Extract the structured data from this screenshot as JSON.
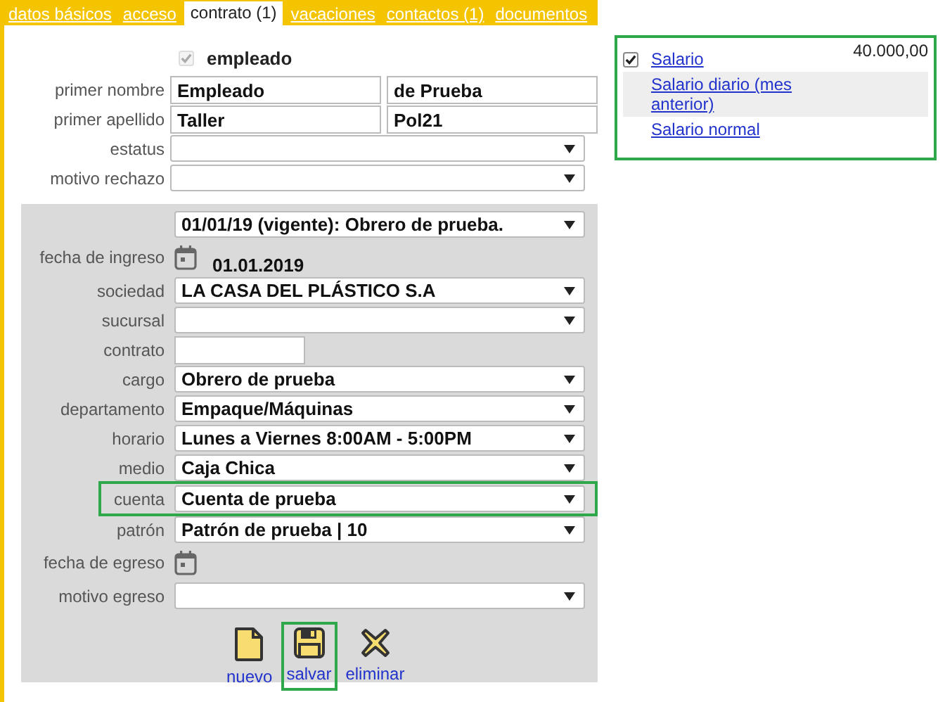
{
  "tabs": [
    {
      "label": "datos básicos",
      "selected": false
    },
    {
      "label": "acceso",
      "selected": false
    },
    {
      "label": "contrato (1)",
      "selected": true
    },
    {
      "label": "vacaciones",
      "selected": false
    },
    {
      "label": "contactos (1)",
      "selected": false
    },
    {
      "label": "documentos",
      "selected": false
    }
  ],
  "employee_checkbox": {
    "label": "empleado",
    "checked": true
  },
  "person_fields": [
    {
      "label": "primer nombre",
      "kind": "pair",
      "values": [
        "Empleado",
        "de Prueba"
      ]
    },
    {
      "label": "primer apellido",
      "kind": "pair",
      "values": [
        "Taller",
        "Pol21"
      ]
    },
    {
      "label": "estatus",
      "kind": "select"
    },
    {
      "label": "motivo rechazo",
      "kind": "select"
    }
  ],
  "contract": {
    "selector": "01/01/19 (vigente): Obrero de prueba.",
    "fields": [
      {
        "label": "fecha de ingreso",
        "kind": "date",
        "value": "01.01.2019",
        "highlighted": false
      },
      {
        "label": "sociedad",
        "kind": "select",
        "value": "LA CASA DEL PLÁSTICO S.A",
        "highlighted": false
      },
      {
        "label": "sucursal",
        "kind": "select",
        "highlighted": false
      },
      {
        "label": "contrato",
        "kind": "text",
        "highlighted": false
      },
      {
        "label": "cargo",
        "kind": "select",
        "value": "Obrero de prueba",
        "highlighted": false
      },
      {
        "label": "departamento",
        "kind": "select",
        "value": "Empaque/Máquinas",
        "highlighted": false
      },
      {
        "label": "horario",
        "kind": "select",
        "value": "Lunes a Viernes 8:00AM - 5:00PM",
        "highlighted": false
      },
      {
        "label": "medio",
        "kind": "select",
        "value": "Caja Chica",
        "highlighted": false
      },
      {
        "label": "cuenta",
        "kind": "select",
        "value": "Cuenta de prueba",
        "highlighted": true
      },
      {
        "label": "patrón",
        "kind": "select",
        "value": "Patrón de prueba | 10",
        "highlighted": false
      },
      {
        "label": "fecha de egreso",
        "kind": "date",
        "highlighted": false
      },
      {
        "label": "motivo egreso",
        "kind": "select",
        "highlighted": false
      }
    ],
    "actions": [
      {
        "label": "nuevo",
        "highlighted": false
      },
      {
        "label": "salvar",
        "highlighted": true
      },
      {
        "label": "eliminar",
        "highlighted": false
      }
    ]
  },
  "salary_panel": {
    "highlighted": true,
    "items": [
      {
        "kind": "checkbox",
        "checked": true,
        "label": "Salario",
        "amount": "40.000,00"
      },
      {
        "kind": "link",
        "label": "Salario diario (mes anterior)"
      },
      {
        "kind": "link",
        "label": "Salario normal"
      }
    ]
  }
}
